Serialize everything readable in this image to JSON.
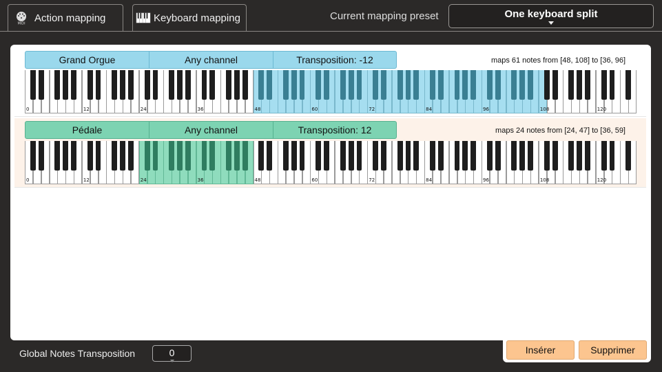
{
  "tabs": {
    "action_label": "Action mapping",
    "keyboard_label": "Keyboard mapping"
  },
  "preset": {
    "label": "Current mapping preset",
    "value": "One keyboard split"
  },
  "mappings": [
    {
      "name": "Grand Orgue",
      "channel": "Any channel",
      "transposition": "Transposition: -12",
      "summary": "maps 61 notes from [48, 108] to [36, 96]",
      "range": [
        48,
        108
      ],
      "color": "blue"
    },
    {
      "name": "Pédale",
      "channel": "Any channel",
      "transposition": "Transposition: 12",
      "summary": "maps 24 notes from [24, 47] to [36, 59]",
      "range": [
        24,
        47
      ],
      "color": "green"
    }
  ],
  "keyboard_labels": [
    "0",
    "12",
    "24",
    "36",
    "48",
    "60",
    "72",
    "84",
    "96",
    "108",
    "120"
  ],
  "footer": {
    "global_label": "Global Notes Transposition",
    "global_value": "0",
    "insert_label": "Insérer",
    "delete_label": "Supprimer"
  },
  "colors": {
    "blue": "#9ad8ec",
    "green": "#7dd3b2",
    "button": "#fcc58f"
  }
}
